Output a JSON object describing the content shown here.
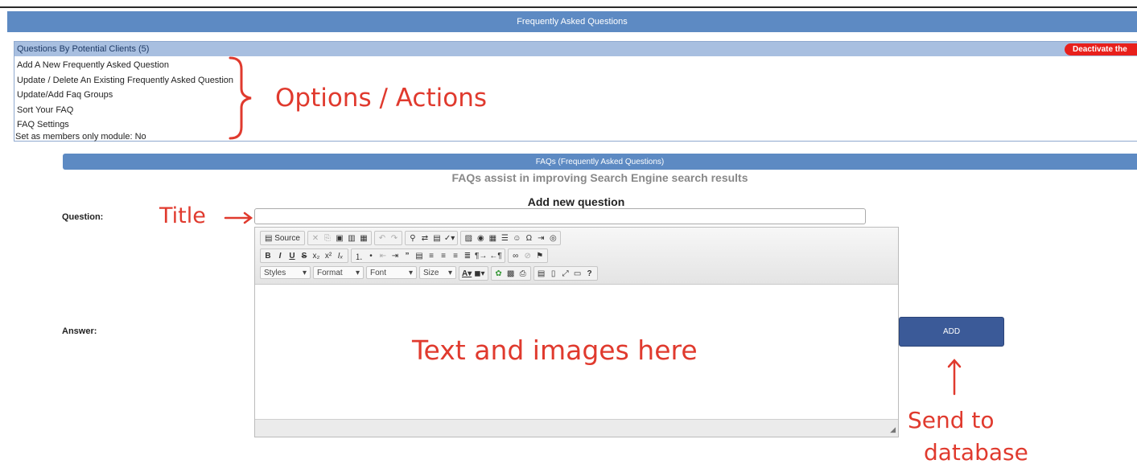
{
  "page": {
    "banner_title": "Frequently Asked Questions",
    "options_header": "Questions By Potential Clients (5)",
    "deactivate_label": "Deactivate the",
    "options": [
      "Add A New Frequently Asked Question",
      "Update / Delete An Existing Frequently Asked Question",
      "Update/Add Faq Groups",
      "Sort Your FAQ",
      "FAQ Settings"
    ],
    "members_only": "Set as members only module: No",
    "faq_bar_title": "FAQs (Frequently Asked Questions)",
    "faq_subtitle": "FAQs assist in improving Search Engine search results",
    "form_title": "Add new question",
    "question_label": "Question:",
    "answer_label": "Answer:",
    "question_value": "",
    "add_button": "ADD"
  },
  "editor": {
    "source_label": "Source",
    "styles_label": "Styles",
    "format_label": "Format",
    "font_label": "Font",
    "size_label": "Size"
  },
  "annotations": {
    "options_actions": "Options / Actions",
    "title": "Title",
    "text_images": "Text and images here",
    "send_line1": "Send to",
    "send_line2": "database"
  },
  "colors": {
    "banner": "#5d8ac3",
    "options_header": "#a8bfe0",
    "deactivate": "#e8201c",
    "add_button": "#3b5a98",
    "annotation": "#e03a2e"
  }
}
